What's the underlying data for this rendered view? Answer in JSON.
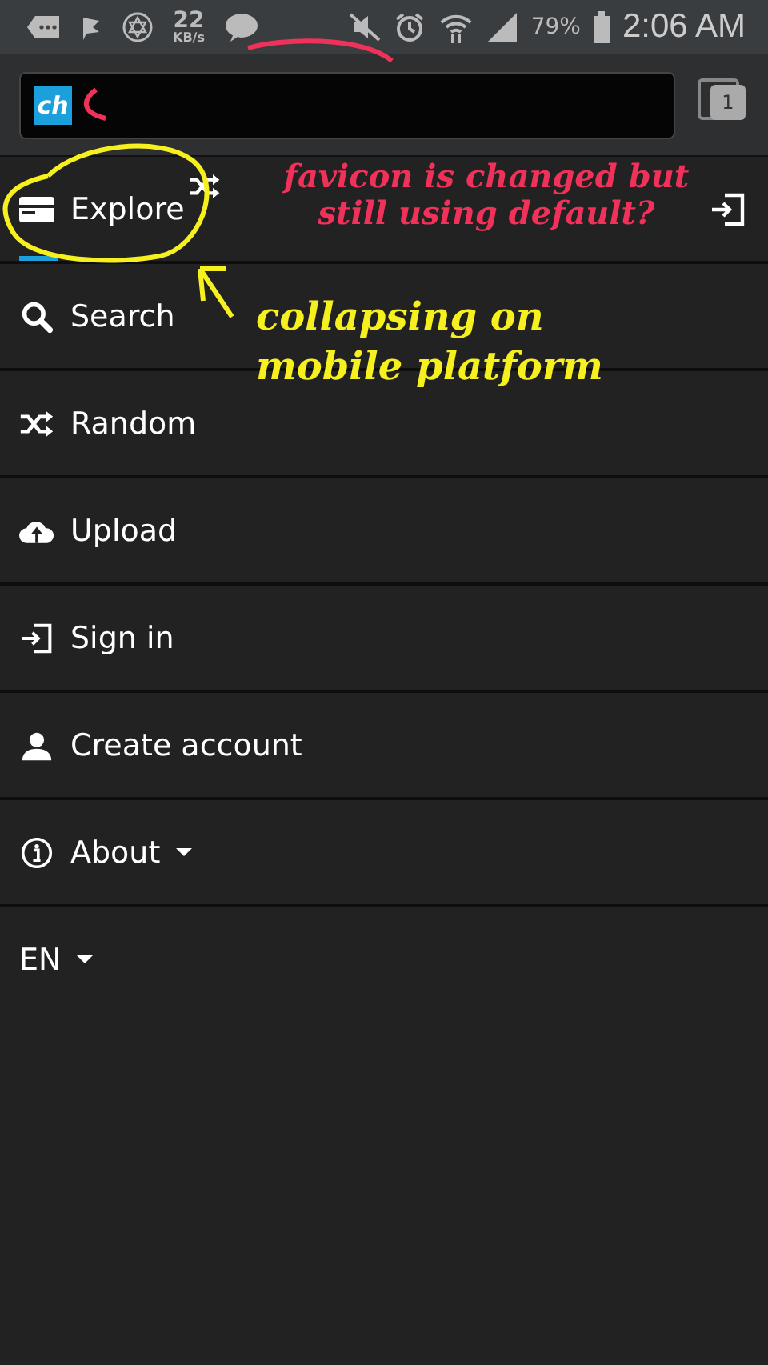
{
  "status_bar": {
    "speed": "22",
    "speed_unit": "KB/s",
    "battery": "79%",
    "time": "2:06 AM"
  },
  "browser_bar": {
    "favicon": "ch",
    "tab_count": "1"
  },
  "menu": [
    {
      "label": "Explore",
      "kind": "card",
      "selected": true,
      "dropdown": false
    },
    {
      "label": "Search",
      "kind": "search",
      "selected": false,
      "dropdown": false
    },
    {
      "label": "Random",
      "kind": "shuffle",
      "selected": false,
      "dropdown": false
    },
    {
      "label": "Upload",
      "kind": "upload",
      "selected": false,
      "dropdown": false
    },
    {
      "label": "Sign in",
      "kind": "signin",
      "selected": false,
      "dropdown": false
    },
    {
      "label": "Create account",
      "kind": "user",
      "selected": false,
      "dropdown": false
    },
    {
      "label": "About",
      "kind": "info",
      "selected": false,
      "dropdown": true
    },
    {
      "label": "EN",
      "kind": "plain",
      "selected": false,
      "dropdown": true
    }
  ],
  "annotations": [
    {
      "text": "favicon is changed but still using default?",
      "color": "#f0325a"
    },
    {
      "text": "collapsing on mobile platform",
      "color": "#f5f01e"
    }
  ]
}
